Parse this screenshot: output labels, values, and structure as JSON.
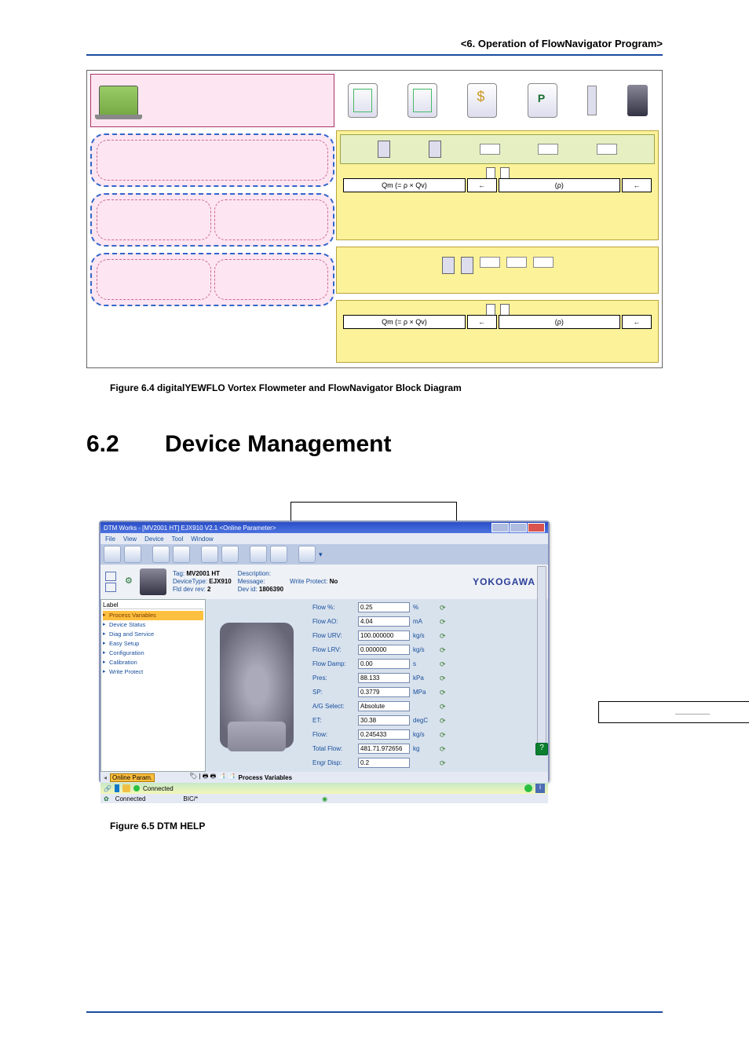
{
  "header": "<6.  Operation of FlowNavigator Program>",
  "fig1_caption": "Figure 6.4     digitalYEWFLO Vortex Flowmeter and FlowNavigator Block Diagram",
  "qm": "Qm (= ρ × Qv)",
  "rho": "(ρ)",
  "section": {
    "num": "6.2",
    "title": "Device Management"
  },
  "app": {
    "title": "DTM Works - [MV2001 HT] EJX910 V2.1 <Online Parameter>",
    "menus": [
      "File",
      "View",
      "Device",
      "Tool",
      "Window"
    ],
    "yoko": "YOKOGAWA",
    "hdr": {
      "tag_l": "Tag:",
      "tag_v": "MV2001 HT",
      "type_l": "DeviceType:",
      "type_v": "EJX910",
      "fld_l": "Fld dev rev:",
      "fld_v": "2",
      "desc_l": "Description:",
      "desc_v": "",
      "msg_l": "Message:",
      "msg_v": "",
      "dev_l": "Dev id:",
      "dev_v": "1806390",
      "wp_l": "Write Protect:",
      "wp_v": "No"
    },
    "tree": {
      "label": "Label",
      "items": [
        "Process Variables",
        "Device Status",
        "Diag and Service",
        "Easy Setup",
        "Configuration",
        "Calibration",
        "Write Protect"
      ]
    },
    "params": [
      {
        "label": "Flow %:",
        "value": "0.25",
        "unit": "%"
      },
      {
        "label": "Flow AO:",
        "value": "4.04",
        "unit": "mA"
      },
      {
        "label": "Flow URV:",
        "value": "100.000000",
        "unit": "kg/s"
      },
      {
        "label": "Flow LRV:",
        "value": "0.000000",
        "unit": "kg/s"
      },
      {
        "label": "Flow Damp:",
        "value": "0.00",
        "unit": "s"
      },
      {
        "label": "Pres:",
        "value": "88.133",
        "unit": "kPa"
      },
      {
        "label": "SP:",
        "value": "0.3779",
        "unit": "MPa"
      },
      {
        "label": "A/G Select:",
        "value": "Absolute",
        "unit": ""
      },
      {
        "label": "ET:",
        "value": "30.38",
        "unit": "degC"
      },
      {
        "label": "Flow:",
        "value": "0.245433",
        "unit": "kg/s"
      },
      {
        "label": "Total Flow:",
        "value": "481.71.972656",
        "unit": "kg"
      },
      {
        "label": "Engr Disp:",
        "value": "0.2",
        "unit": ""
      }
    ],
    "status": {
      "op": "Online Param.",
      "pv": "Process Variables",
      "connected": "Connected",
      "connected2": "Connected",
      "bic": "BIC/*"
    }
  },
  "fig2_caption": "Figure 6.5     DTM HELP"
}
